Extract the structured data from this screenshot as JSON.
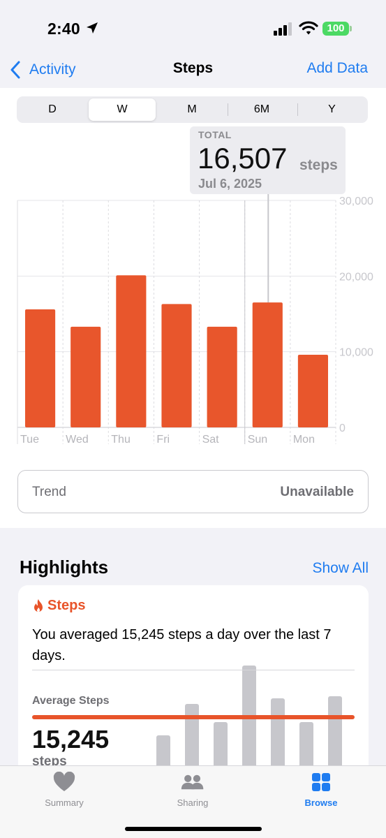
{
  "status_bar": {
    "time": "2:40",
    "battery": "100"
  },
  "nav": {
    "back_label": "Activity",
    "title": "Steps",
    "action_label": "Add Data"
  },
  "segmented": {
    "options": [
      "D",
      "W",
      "M",
      "6M",
      "Y"
    ],
    "selected": "W"
  },
  "tooltip": {
    "label": "TOTAL",
    "value": "16,507",
    "unit": "steps",
    "date": "Jul 6, 2025"
  },
  "chart_data": {
    "type": "bar",
    "categories": [
      "Tue",
      "Wed",
      "Thu",
      "Fri",
      "Sat",
      "Sun",
      "Mon"
    ],
    "values": [
      15600,
      13300,
      20100,
      16300,
      13300,
      16507,
      9600
    ],
    "y_ticks": [
      "30,000",
      "20,000",
      "10,000",
      "0"
    ],
    "ylim": [
      0,
      30000
    ],
    "highlighted_category": "Sun",
    "bar_color": "#e8562c",
    "grid": true
  },
  "trend": {
    "label": "Trend",
    "value": "Unavailable"
  },
  "highlights": {
    "title": "Highlights",
    "show_all": "Show All",
    "card": {
      "category": "Steps",
      "icon": "flame-icon",
      "text": "You averaged 15,245 steps a day over the last 7 days.",
      "avg_label": "Average Steps",
      "avg_value": "15,245",
      "avg_unit": "steps",
      "mini_bar_values": [
        0.45,
        0.9,
        0.64,
        1.45,
        0.98,
        0.64,
        1.01
      ],
      "average_line_color": "#e8542a"
    }
  },
  "tabbar": {
    "items": [
      {
        "label": "Summary",
        "icon": "heart-icon"
      },
      {
        "label": "Sharing",
        "icon": "people-icon"
      },
      {
        "label": "Browse",
        "icon": "grid-icon"
      }
    ],
    "selected": "Browse"
  },
  "colors": {
    "accent": "#1f7cf0",
    "steps_orange": "#e8562c"
  }
}
